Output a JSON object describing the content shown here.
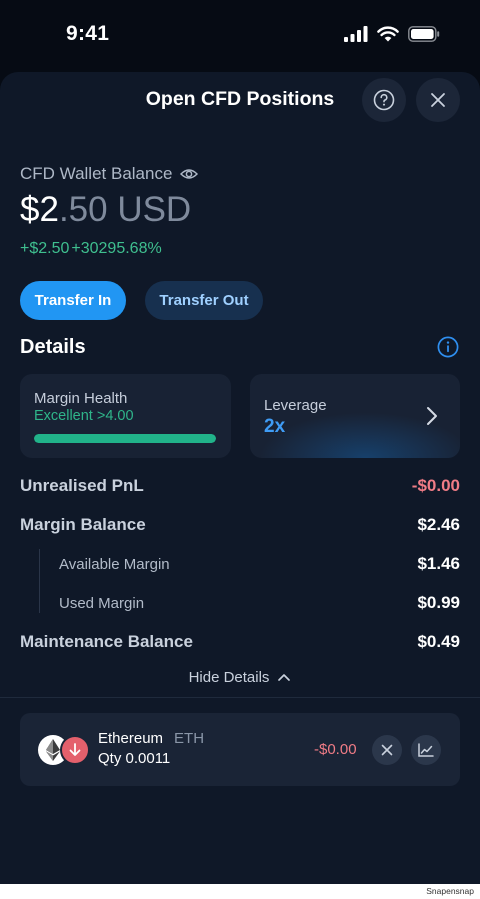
{
  "status_bar": {
    "time": "9:41"
  },
  "header": {
    "title": "Open CFD Positions"
  },
  "wallet": {
    "label": "CFD Wallet Balance",
    "balance_main": "$2",
    "balance_decimal": ".50 USD",
    "change_amount": "+$2.50",
    "change_percent": "+30295.68%"
  },
  "actions": {
    "transfer_in": "Transfer In",
    "transfer_out": "Transfer Out"
  },
  "details": {
    "title": "Details",
    "margin_health": {
      "label": "Margin Health",
      "status": "Excellent >4.00",
      "fill_fraction": 1.0
    },
    "leverage": {
      "label": "Leverage",
      "value": "2x"
    },
    "rows": {
      "unrealised_pnl": {
        "label": "Unrealised PnL",
        "value": "-$0.00"
      },
      "margin_balance": {
        "label": "Margin Balance",
        "value": "$2.46"
      },
      "available_margin": {
        "label": "Available Margin",
        "value": "$1.46"
      },
      "used_margin": {
        "label": "Used Margin",
        "value": "$0.99"
      },
      "maintenance_balance": {
        "label": "Maintenance Balance",
        "value": "$0.49"
      }
    },
    "hide_label": "Hide Details"
  },
  "position": {
    "name": "Ethereum",
    "symbol": "ETH",
    "qty": "Qty 0.0011",
    "pnl": "-$0.00"
  },
  "footer": {
    "watermark": "Snapensnap"
  },
  "colors": {
    "accent": "#2196f3",
    "positive": "#3fbf8f",
    "negative": "#f07c86",
    "sheet_bg": "#0f1828"
  },
  "icons": [
    "signal-icon",
    "wifi-icon",
    "battery-icon",
    "help-icon",
    "close-icon",
    "eye-icon",
    "info-icon",
    "chevron-right-icon",
    "chevron-up-icon",
    "ethereum-icon",
    "arrow-down-icon",
    "chart-icon"
  ]
}
